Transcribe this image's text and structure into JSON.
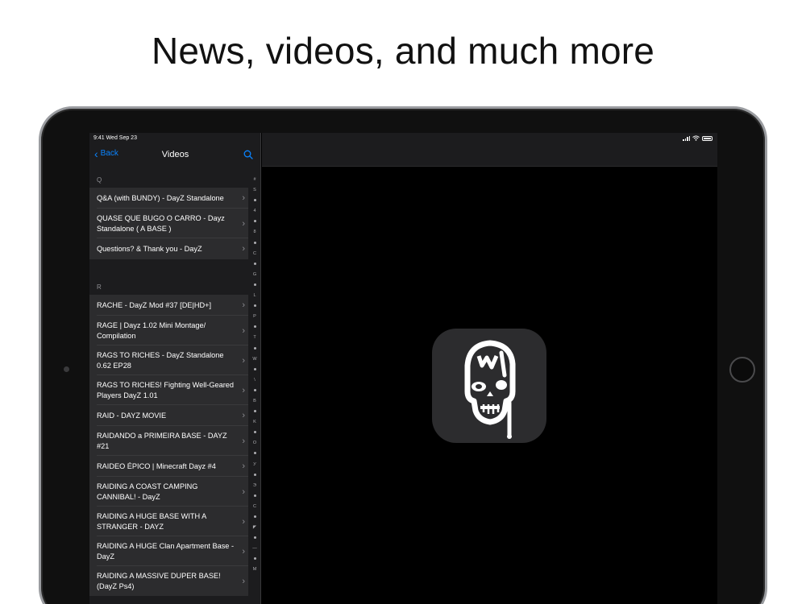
{
  "headline": "News, videos, and much more",
  "status_bar": {
    "time": "9:41  Wed Sep 23"
  },
  "nav": {
    "back_label": "Back",
    "title": "Videos",
    "search_icon": "search-icon"
  },
  "sections": [
    {
      "letter": "Q",
      "rows": [
        {
          "title": "Q&A (with BUNDY) - DayZ Standalone",
          "lines": 1
        },
        {
          "title": "QUASE QUE BUGO O CARRO - Dayz Standalone ( A BASE )",
          "lines": 2
        },
        {
          "title": "Questions? & Thank you - DayZ",
          "lines": 1
        }
      ]
    },
    {
      "letter": "R",
      "rows": [
        {
          "title": "RACHE - DayZ Mod #37 [DE|HD+]",
          "lines": 1
        },
        {
          "title": "RAGE | Dayz 1.02 Mini Montage/ Compilation",
          "lines": 2
        },
        {
          "title": "RAGS TO RICHES - DayZ Standalone 0.62 EP28",
          "lines": 2
        },
        {
          "title": "RAGS TO RICHES! Fighting Well-Geared Players DayZ 1.01",
          "lines": 2
        },
        {
          "title": "RAID - DAYZ MOVIE",
          "lines": 1
        },
        {
          "title": "RAIDANDO a PRIMEIRA BASE - DAYZ #21",
          "lines": 2
        },
        {
          "title": "RAIDEO ÉPICO | Minecraft Dayz #4",
          "lines": 1
        },
        {
          "title": "RAIDING A COAST CAMPING CANNIBAL! - DayZ",
          "lines": 2
        },
        {
          "title": "RAIDING A HUGE BASE WITH A STRANGER - DAYZ",
          "lines": 2
        },
        {
          "title": "RAIDING A HUGE Clan Apartment Base - DayZ",
          "lines": 2
        },
        {
          "title": "RAIDING A MASSIVE DUPER BASE! (DayZ Ps4)",
          "lines": 2
        }
      ]
    }
  ],
  "section_index": [
    "#",
    "S",
    "·",
    "4",
    "·",
    "8",
    "·",
    "C",
    "·",
    "G",
    "·",
    "L",
    "·",
    "P",
    "·",
    "T",
    "·",
    "W",
    "·",
    "\\",
    "·",
    "B",
    "·",
    "K",
    "·",
    "O",
    "·",
    "У",
    "·",
    "Э",
    "·",
    "С",
    "·",
    "◤",
    "·",
    "—",
    "·",
    "M"
  ],
  "colors": {
    "accent": "#0a84ff",
    "background": "#000000",
    "sidebar": "#1c1c1e",
    "cell": "#2c2c2e"
  },
  "app_icon": "zombie-skull-icon"
}
